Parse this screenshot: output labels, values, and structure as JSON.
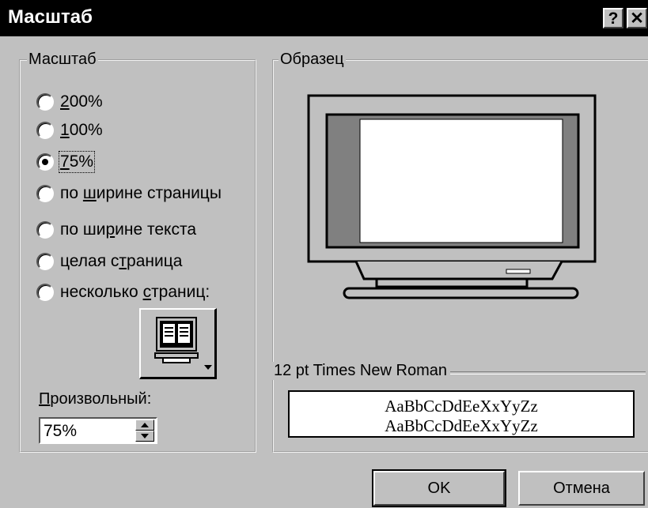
{
  "title": "Масштаб",
  "titlebar": {
    "help": "?",
    "close": "✕"
  },
  "scale_group": {
    "title": "Масштаб",
    "options": [
      {
        "pre": "",
        "ul": "2",
        "post": "00%",
        "checked": false
      },
      {
        "pre": "",
        "ul": "1",
        "post": "00%",
        "checked": false
      },
      {
        "pre": "",
        "ul": "7",
        "post": "5%",
        "checked": true
      },
      {
        "pre": "по ",
        "ul": "ш",
        "post": "ирине страницы",
        "checked": false
      },
      {
        "pre": "по ши",
        "ul": "р",
        "post": "ине текста",
        "checked": false
      },
      {
        "pre": "целая с",
        "ul": "т",
        "post": "раница",
        "checked": false
      },
      {
        "pre": "несколько ",
        "ul": "с",
        "post": "траниц:",
        "checked": false
      }
    ],
    "custom_label_ul": "П",
    "custom_label_rest": "роизвольный:",
    "custom_value": "75%"
  },
  "preview_group": {
    "title": "Образец",
    "font_title": "12 pt Times New Roman",
    "sample_lines": [
      "AaBbCcDdEeXxYyZz",
      "AaBbCcDdEeXxYyZz"
    ]
  },
  "buttons": {
    "ok": "OK",
    "cancel": "Отмена"
  }
}
